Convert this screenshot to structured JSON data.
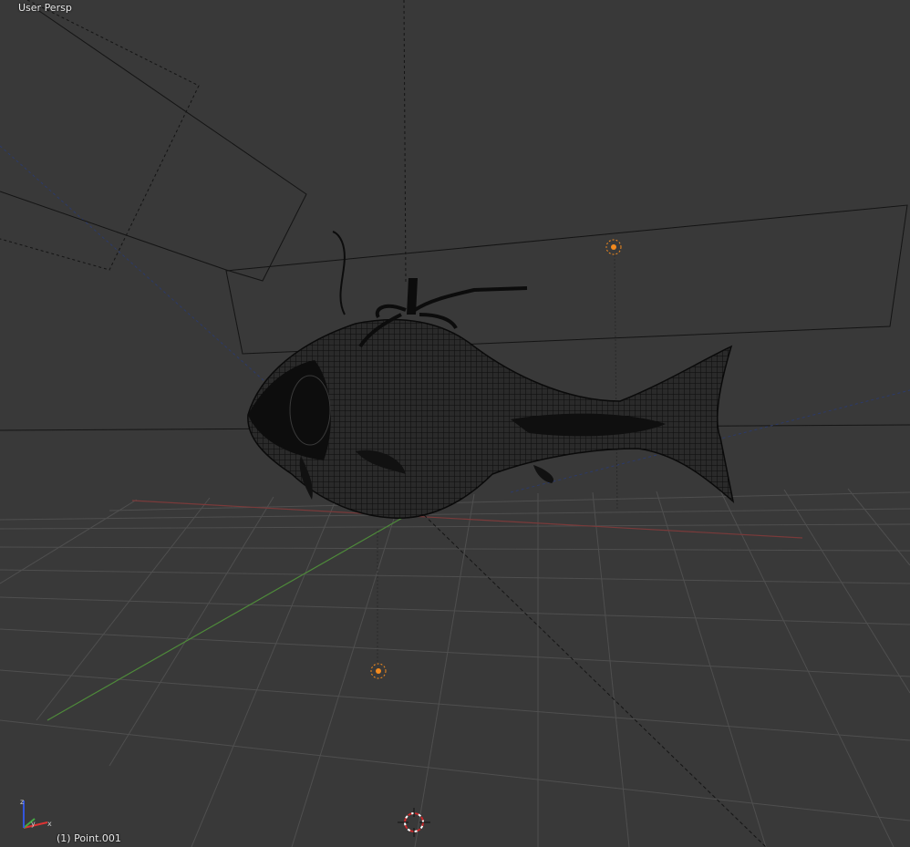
{
  "viewport": {
    "view_name": "User Persp",
    "active_object": "(1) Point.001"
  },
  "colors": {
    "background": "#393939",
    "grid": "#4e4e4e",
    "x_axis": "#8a3c3c",
    "y_axis": "#4c8a3c",
    "wire": "#111111",
    "lamp": "#f28a1e",
    "cursor_red": "#c8282a"
  },
  "icons": {
    "axis_gizmo": "xyz-axis-icon",
    "lamps": [
      "lamp-icon",
      "lamp-icon"
    ],
    "cursor": "3d-cursor-icon"
  }
}
